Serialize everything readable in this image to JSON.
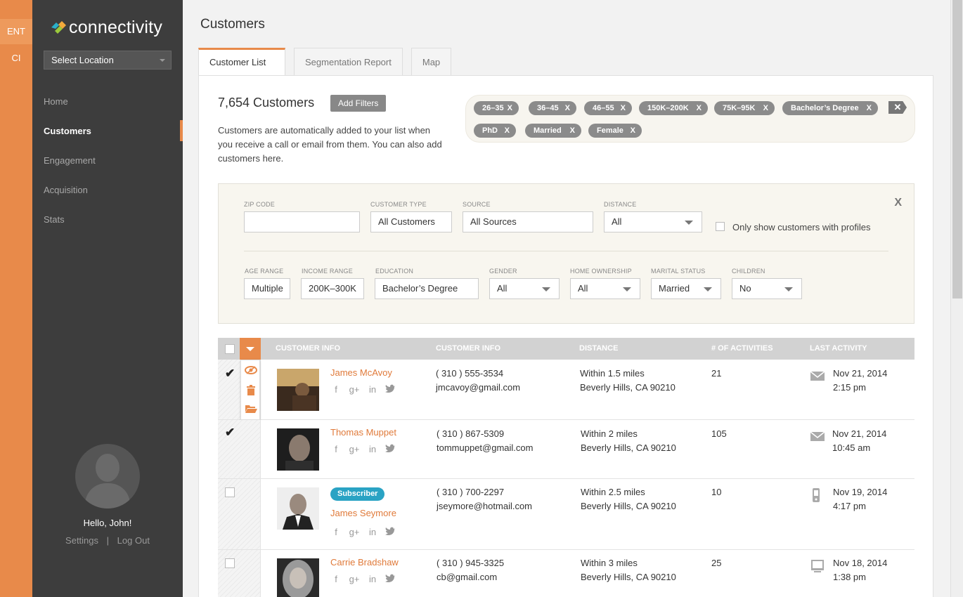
{
  "rail": {
    "items": [
      "ENT",
      "CI"
    ]
  },
  "sidebar": {
    "brand": "connectivity",
    "location_select": "Select Location",
    "nav": [
      "Home",
      "Customers",
      "Engagement",
      "Acquisition",
      "Stats"
    ],
    "greeting": "Hello, John!",
    "settings": "Settings",
    "separator": "|",
    "logout": "Log Out"
  },
  "page": {
    "title": "Customers",
    "tabs": [
      "Customer List",
      "Segmentation Report",
      "Map"
    ]
  },
  "summary": {
    "count": "7,654 Customers",
    "add_filters": "Add Filters",
    "description": "Customers are automatically added to your list when you receive a call or email from them. You can also add customers here."
  },
  "chips": [
    "26–35",
    "36–45",
    "46–55",
    "150K–200K",
    "75K–95K",
    "Bachelor’s Degree",
    "PhD",
    "Married",
    "Female"
  ],
  "chip_close": "X",
  "filters": {
    "close": "X",
    "zip_label": "ZIP CODE",
    "zip_value": "",
    "type_label": "CUSTOMER TYPE",
    "type_value": "All Customers",
    "source_label": "SOURCE",
    "source_value": "All Sources",
    "distance_label": "DISTANCE",
    "distance_value": "All",
    "profiles_label": "Only show customers with profiles",
    "age_label": "AGE RANGE",
    "age_value": "Multiple",
    "income_label": "INCOME RANGE",
    "income_value": "200K–300K",
    "education_label": "EDUCATION",
    "education_value": "Bachelor’s Degree",
    "gender_label": "GENDER",
    "gender_value": "All",
    "home_label": "HOME OWNERSHIP",
    "home_value": "All",
    "marital_label": "MARITAL STATUS",
    "marital_value": "Married",
    "children_label": "CHILDREN",
    "children_value": "No"
  },
  "table": {
    "headers": [
      "CUSTOMER INFO",
      "CUSTOMER INFO",
      "DISTANCE",
      "# OF ACTIVITIES",
      "LAST ACTIVITY"
    ],
    "rows": [
      {
        "name": "James McAvoy",
        "phone": "( 310 ) 555-3534",
        "email": "jmcavoy@gmail.com",
        "distance": "Within 1.5 miles",
        "location": "Beverly Hills, CA 90210",
        "activities": "21",
        "date": "Nov 21, 2014",
        "time": "2:15 pm",
        "activity_icon": "mail-icon",
        "checked": true
      },
      {
        "name": "Thomas Muppet",
        "phone": "( 310 ) 867-5309",
        "email": "tommuppet@gmail.com",
        "distance": "Within 2 miles",
        "location": "Beverly Hills, CA 90210",
        "activities": "105",
        "date": "Nov 21, 2014",
        "time": "10:45 am",
        "activity_icon": "mail-icon",
        "checked": true
      },
      {
        "badge": "Subscriber",
        "name": "James Seymore",
        "phone": "( 310 ) 700-2297",
        "email": "jseymore@hotmail.com",
        "distance": "Within 2.5 miles",
        "location": "Beverly Hills, CA 90210",
        "activities": "10",
        "date": "Nov 19, 2014",
        "time": "4:17 pm",
        "activity_icon": "phone-icon",
        "checked": false
      },
      {
        "name": "Carrie Bradshaw",
        "phone": "( 310 ) 945-3325",
        "email": "cb@gmail.com",
        "distance": "Within 3 miles",
        "location": "Beverly Hills, CA 90210",
        "activities": "25",
        "date": "Nov 18, 2014",
        "time": "1:38 pm",
        "activity_icon": "monitor-icon",
        "checked": false
      }
    ],
    "social": [
      "f",
      "g+",
      "in"
    ]
  },
  "colors": {
    "accent": "#e88a4a",
    "sidebar": "#3d3d3d",
    "badge": "#2aa3c4",
    "link": "#e07a3a"
  }
}
